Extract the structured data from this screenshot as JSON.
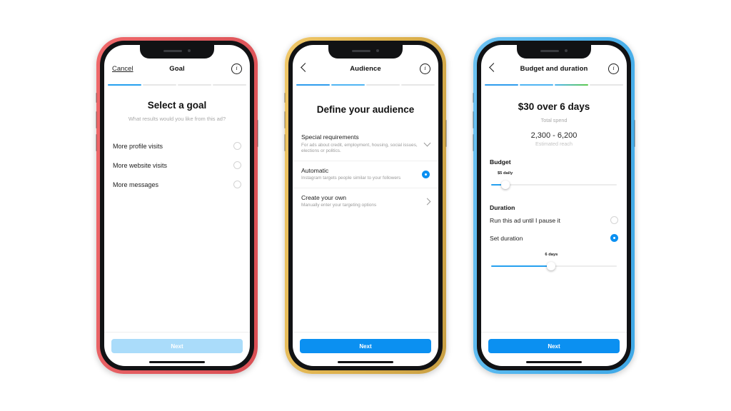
{
  "canvas": {
    "background": "#ffffff"
  },
  "accent": {
    "blue": "#0b90f1",
    "blue_light": "#aadcfa",
    "green": "#5dc94a",
    "track_gray": "#ececec"
  },
  "phones": [
    {
      "frame_color": "#e35c60",
      "frame_name": "red",
      "nav": {
        "left_label": "Cancel",
        "title": "Goal",
        "info_glyph": "i"
      },
      "progress": {
        "segments": 4,
        "filled": 1,
        "styles": [
          "solid-blue",
          "gray",
          "gray",
          "gray"
        ]
      },
      "screen": {
        "heading": "Select a goal",
        "subheading": "What results would you like from this ad?",
        "options": [
          {
            "label": "More profile visits",
            "selected": false
          },
          {
            "label": "More website visits",
            "selected": false
          },
          {
            "label": "More messages",
            "selected": false
          }
        ]
      },
      "cta": {
        "label": "Next",
        "disabled": true
      }
    },
    {
      "frame_color": "#e0b44f",
      "frame_name": "gold",
      "nav": {
        "left_label": "",
        "title": "Audience",
        "info_glyph": "i"
      },
      "progress": {
        "segments": 4,
        "filled": 2,
        "styles": [
          "solid-blue",
          "light-blue",
          "gray",
          "gray"
        ]
      },
      "screen": {
        "heading": "Define your audience",
        "rows": [
          {
            "title": "Special requirements",
            "subtitle": "For ads about credit, employment, housing, social issues, elections or politics.",
            "control": "chevron-down-icon",
            "selected": false
          },
          {
            "title": "Automatic",
            "subtitle": "Instagram targets people similar to your followers",
            "control": "radio",
            "selected": true
          },
          {
            "title": "Create your own",
            "subtitle": "Manually enter your targeting options",
            "control": "chevron-right-icon",
            "selected": false
          }
        ]
      },
      "cta": {
        "label": "Next",
        "disabled": false
      }
    },
    {
      "frame_color": "#53b6ee",
      "frame_name": "blue",
      "nav": {
        "left_label": "",
        "title": "Budget and duration",
        "info_glyph": "i"
      },
      "progress": {
        "segments": 4,
        "filled": 3,
        "styles": [
          "solid-blue",
          "light-blue",
          "blue-green-gradient",
          "gray"
        ]
      },
      "screen": {
        "amount": "$30 over 6 days",
        "amount_caption": "Total spend",
        "reach": "2,300 - 6,200",
        "reach_caption": "Estimated reach",
        "budget": {
          "section_label": "Budget",
          "slider_value_label": "$5 daily",
          "slider_percent": 12
        },
        "duration": {
          "section_label": "Duration",
          "options": [
            {
              "label": "Run this ad until I pause it",
              "selected": false
            },
            {
              "label": "Set duration",
              "selected": true
            }
          ],
          "slider_value_label": "6 days",
          "slider_percent": 48
        }
      },
      "cta": {
        "label": "Next",
        "disabled": false
      }
    }
  ]
}
